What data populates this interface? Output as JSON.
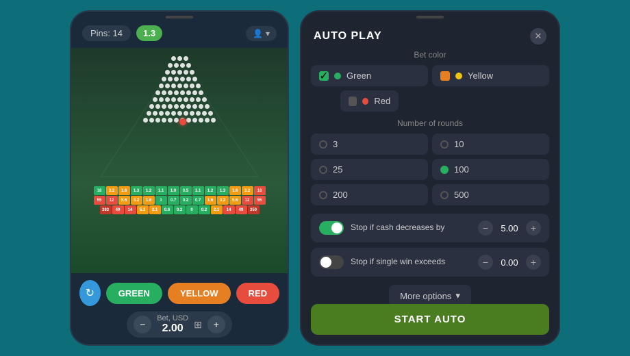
{
  "left_phone": {
    "pins_label": "Pins: 14",
    "multiplier": "1.3",
    "user_icon": "👤",
    "chevron": "▾",
    "bet_label": "Bet, USD",
    "bet_value": "2.00",
    "buttons": {
      "green": "GREEN",
      "yellow": "YELLOW",
      "red": "RED"
    },
    "pin_rows": [
      3,
      4,
      5,
      6,
      7,
      8,
      9,
      10,
      11,
      12,
      13,
      14
    ],
    "score_rows": [
      {
        "values": [
          "18",
          "3.2",
          "1.6",
          "1.3",
          "1.2",
          "1.1",
          "1.0",
          "0.5",
          "1.1",
          "1.2",
          "1.3",
          "1.6",
          "3.2",
          "18"
        ],
        "colors": [
          "red",
          "yellow",
          "yellow",
          "green",
          "green",
          "green",
          "green",
          "green",
          "green",
          "green",
          "green",
          "yellow",
          "yellow",
          "red"
        ]
      },
      {
        "values": [
          "55",
          "12",
          "5.6",
          "3.2",
          "1.6",
          "1",
          "0.7",
          "0.2",
          "0.7",
          "1.6",
          "3.2",
          "5.6",
          "12",
          "55"
        ],
        "colors": [
          "red",
          "red",
          "yellow",
          "yellow",
          "yellow",
          "green",
          "green",
          "green",
          "green",
          "yellow",
          "yellow",
          "yellow",
          "red",
          "red"
        ]
      },
      {
        "values": [
          "383",
          "49",
          "14",
          "5.3",
          "2.1",
          "0.6",
          "0.2",
          "0",
          "0.2",
          "2.1",
          "14",
          "49",
          "350"
        ],
        "colors": [
          "dark-red",
          "red",
          "red",
          "yellow",
          "yellow",
          "green",
          "green",
          "green",
          "green",
          "yellow",
          "yellow",
          "red",
          "dark-red"
        ]
      }
    ]
  },
  "right_panel": {
    "title": "AUTO PLAY",
    "close_icon": "✕",
    "bet_color_label": "Bet color",
    "colors": [
      {
        "id": "green",
        "label": "Green",
        "dot_color": "green",
        "checked": true
      },
      {
        "id": "yellow",
        "label": "Yellow",
        "dot_color": "yellow",
        "checked": false
      },
      {
        "id": "red",
        "label": "Red",
        "dot_color": "red",
        "checked": false
      }
    ],
    "rounds_label": "Number of rounds",
    "rounds": [
      {
        "value": "3",
        "active": false
      },
      {
        "value": "10",
        "active": false
      },
      {
        "value": "25",
        "active": false
      },
      {
        "value": "100",
        "active": true
      },
      {
        "value": "200",
        "active": false
      },
      {
        "value": "500",
        "active": false
      }
    ],
    "stop_cash": {
      "label": "Stop if cash decreases by",
      "value": "5.00",
      "enabled": true
    },
    "stop_win": {
      "label": "Stop if single win exceeds",
      "value": "0.00",
      "enabled": false
    },
    "more_options_label": "More options",
    "start_button_label": "START AUTO"
  }
}
